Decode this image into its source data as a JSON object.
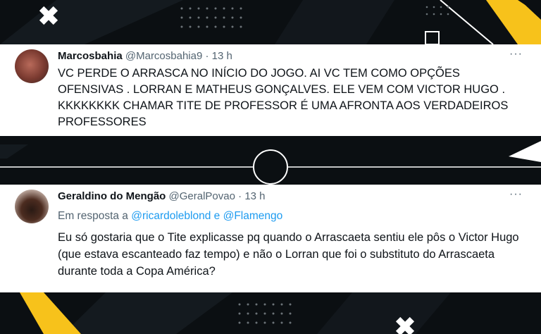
{
  "tweets": [
    {
      "display_name": "Marcosbahia",
      "handle": "@Marcosbahia9",
      "separator": "·",
      "time": "13 h",
      "more": "···",
      "text": "VC PERDE O ARRASCA NO INÍCIO DO JOGO. AI VC TEM COMO OPÇÕES OFENSIVAS . LORRAN E MATHEUS GONÇALVES. ELE VEM COM VICTOR HUGO . KKKKKKKK CHAMAR TITE DE PROFESSOR É UMA AFRONTA AOS VERDADEIROS PROFESSORES"
    },
    {
      "display_name": "Geraldino do Mengão",
      "handle": "@GeralPovao",
      "separator": "·",
      "time": "13 h",
      "more": "···",
      "reply_prefix": "Em resposta a",
      "reply_mentions": "@ricardoleblond e @Flamengo",
      "text": "Eu só gostaria que o Tite explicasse pq quando o Arrascaeta sentiu ele pôs o Victor Hugo (que estava escanteado faz tempo) e não o Lorran que foi o substituto do Arrascaeta durante toda a Copa América?"
    }
  ],
  "colors": {
    "background": "#0b0f12",
    "accent_yellow": "#f7c21b",
    "mention_blue": "#1d9bf0",
    "text_secondary": "#536471"
  }
}
